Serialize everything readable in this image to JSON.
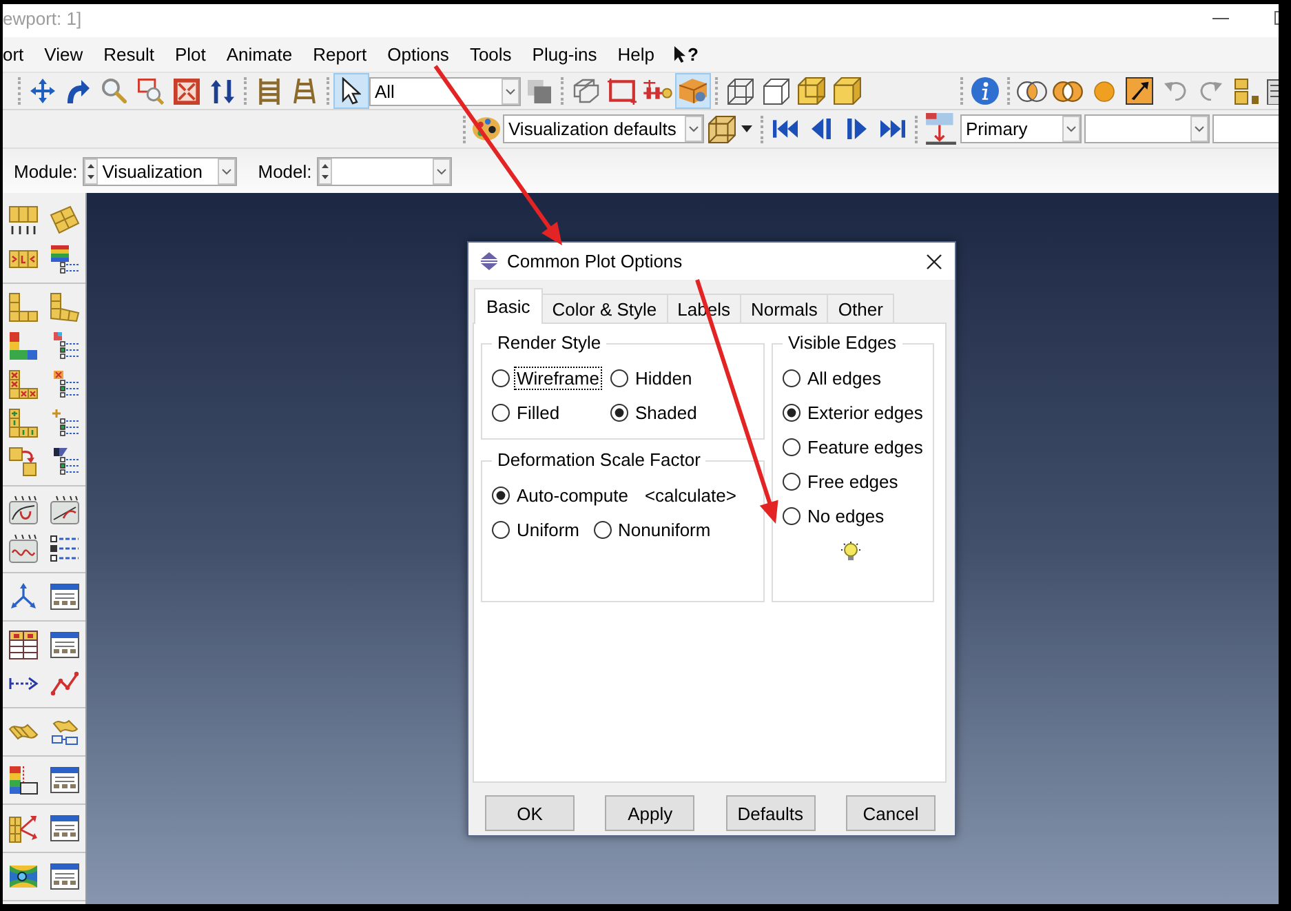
{
  "window": {
    "title": "ewport: 1]"
  },
  "menu_bar": {
    "items": [
      {
        "label": "ort"
      },
      {
        "label": "View"
      },
      {
        "label": "Result"
      },
      {
        "label": "Plot"
      },
      {
        "label": "Animate"
      },
      {
        "label": "Report"
      },
      {
        "label": "Options"
      },
      {
        "label": "Tools"
      },
      {
        "label": "Plug-ins"
      },
      {
        "label": "Help"
      }
    ],
    "help_button": {
      "label": "?"
    }
  },
  "toolbar": {
    "select_tool": {
      "selected": true
    },
    "filter_box": {
      "value": "All"
    },
    "box_tool": {
      "selected": true
    }
  },
  "toolbar_2": {
    "style_box": {
      "value": "Visualization defaults"
    },
    "output_box": {
      "value": "Primary"
    }
  },
  "context_bar": {
    "module": {
      "label": "Module:",
      "value": "Visualization"
    },
    "model": {
      "label": "Model:"
    }
  },
  "dialog": {
    "title": "Common Plot Options",
    "tabs": [
      {
        "label": "Basic",
        "selected": true
      },
      {
        "label": "Color & Style",
        "selected": false
      },
      {
        "label": "Labels",
        "selected": false
      },
      {
        "label": "Normals",
        "selected": false
      },
      {
        "label": "Other",
        "selected": false
      }
    ],
    "render_style": {
      "title": "Render Style",
      "options": [
        {
          "label": "Wireframe",
          "selected": false,
          "focused": true
        },
        {
          "label": "Hidden",
          "selected": false,
          "focused": false
        },
        {
          "label": "Filled",
          "selected": false,
          "focused": false
        },
        {
          "label": "Shaded",
          "selected": true,
          "focused": false
        }
      ]
    },
    "deformation_scale_factor": {
      "title": "Deformation Scale Factor",
      "rows": [
        [
          {
            "label": "Auto-compute",
            "selected": true,
            "note": "<calculate>"
          }
        ],
        [
          {
            "label": "Uniform",
            "selected": false
          },
          {
            "label": "Nonuniform",
            "selected": false
          }
        ]
      ]
    },
    "visible_edges": {
      "title": "Visible Edges",
      "options": [
        {
          "label": "All edges",
          "selected": false
        },
        {
          "label": "Exterior edges",
          "selected": true
        },
        {
          "label": "Feature edges",
          "selected": false
        },
        {
          "label": "Free edges",
          "selected": false
        },
        {
          "label": "No edges",
          "selected": false
        }
      ]
    },
    "buttons": [
      "OK",
      "Apply",
      "Defaults",
      "Cancel"
    ]
  }
}
